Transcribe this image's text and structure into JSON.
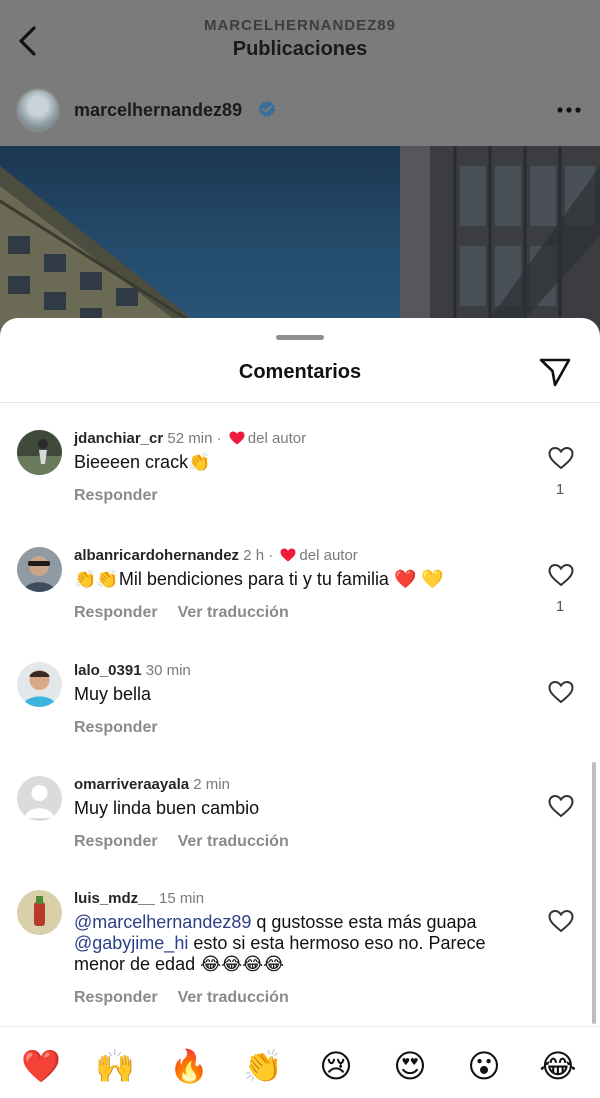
{
  "header": {
    "username": "MARCELHERNANDEZ89",
    "title": "Publicaciones"
  },
  "post": {
    "username": "marcelhernandez89"
  },
  "sheet": {
    "title": "Comentarios"
  },
  "comments": [
    {
      "user": "jdanchiar_cr",
      "time": "52 min",
      "author_like": "del autor",
      "text": "Bieeeen crack👏",
      "reply": "Responder",
      "likes": "1"
    },
    {
      "user": "albanricardohernandez",
      "time": "2 h",
      "author_like": "del autor",
      "text": "👏👏Mil bendiciones para ti y tu familia ❤️ 💛",
      "reply": "Responder",
      "translate": "Ver traducción",
      "likes": "1"
    },
    {
      "user": "lalo_0391",
      "time": "30 min",
      "text": "Muy bella",
      "reply": "Responder"
    },
    {
      "user": "omarriveraayala",
      "time": "2 min",
      "text": "Muy linda buen cambio",
      "reply": "Responder",
      "translate": "Ver traducción"
    },
    {
      "user": "luis_mdz__",
      "time": "15 min",
      "mention1": "@marcelhernandez89",
      "text_part1": " q gustosse esta más guapa ",
      "mention2": "@gabyjime_hi",
      "text_part2": " esto si esta hermoso eso no. Parece menor de edad 😂😂😂😂",
      "reply": "Responder",
      "translate": "Ver traducción"
    }
  ],
  "reactions": [
    "❤️",
    "🙌",
    "🔥",
    "👏",
    "😢",
    "😍",
    "😮",
    "😂"
  ],
  "colors": {
    "like_red": "#ed1c3c",
    "verified_blue": "#3897f0",
    "mention_blue": "#2b3f86"
  }
}
